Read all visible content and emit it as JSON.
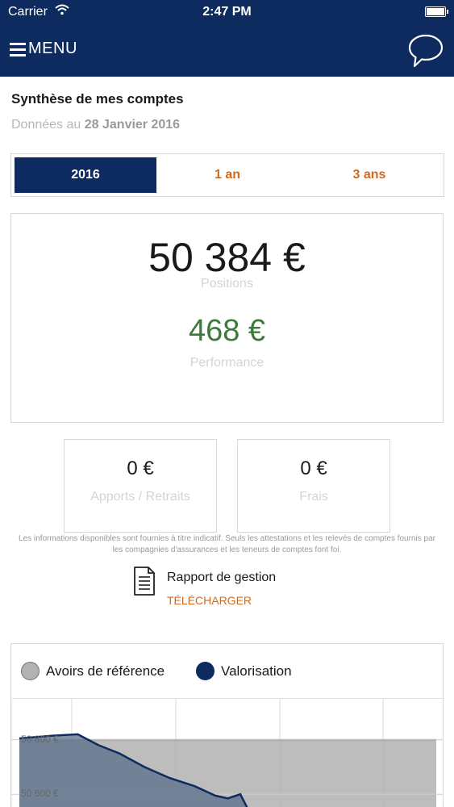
{
  "status_bar": {
    "carrier": "Carrier",
    "time": "2:47 PM"
  },
  "nav": {
    "menu_label": "MENU"
  },
  "header": {
    "title": "Synthèse de mes comptes",
    "date_prefix": "Données au",
    "date_value": "28 Janvier 2016"
  },
  "period_tabs": [
    {
      "label": "2016",
      "active": true
    },
    {
      "label": "1 an",
      "active": false
    },
    {
      "label": "3 ans",
      "active": false
    }
  ],
  "summary": {
    "positions_value": "50 384 €",
    "positions_label": "Positions",
    "performance_value": "468 €",
    "performance_label": "Performance"
  },
  "apports": {
    "value": "0 €",
    "label": "Apports / Retraits"
  },
  "frais": {
    "value": "0 €",
    "label": "Frais"
  },
  "disclaimer": "Les informations disponibles sont fournies à titre indicatif. Seuls les attestations et les relevés de comptes fournis par les compagnies d'assurances et les teneurs de comptes font foi.",
  "report": {
    "title": "Rapport de gestion",
    "download_label": "TÉLÉCHARGER"
  },
  "colors": {
    "navy": "#0d2b5e",
    "accent_orange": "#d06a1c",
    "performance_green": "#3a7a3a",
    "reference_gray": "#b2b2b2"
  },
  "chart_data": {
    "type": "area",
    "legend": [
      "Avoirs de référence",
      "Valorisation"
    ],
    "y_tick_labels": [
      "50 800 €",
      "50 600 €"
    ],
    "y_ticks": [
      50800,
      50600
    ],
    "ylim": [
      50500,
      50950
    ],
    "series": [
      {
        "name": "Avoirs de référence",
        "x": [
          0,
          1
        ],
        "values": [
          50800,
          50800
        ]
      },
      {
        "name": "Valorisation",
        "x": [
          0,
          0.08,
          0.14,
          0.19,
          0.24,
          0.3,
          0.36,
          0.42,
          0.47,
          0.5,
          0.53,
          0.55
        ],
        "values": [
          50805,
          50815,
          50820,
          50780,
          50750,
          50700,
          50660,
          50630,
          50595,
          50585,
          50600,
          50540
        ]
      }
    ],
    "grid": true
  }
}
